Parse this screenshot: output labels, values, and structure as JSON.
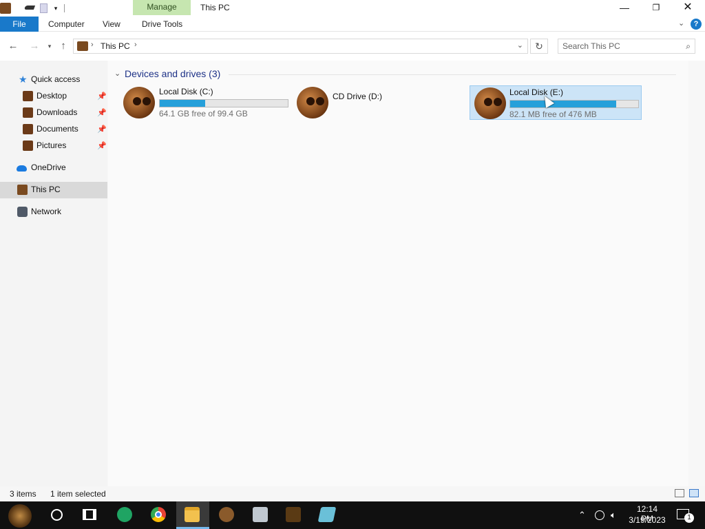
{
  "titlebar": {
    "manage_tab": "Manage",
    "title": "This PC",
    "minimize": "—",
    "maximize": "❐",
    "close": "✕"
  },
  "ribbon": {
    "tabs": [
      "File",
      "Computer",
      "View",
      "Drive Tools"
    ],
    "help": "?"
  },
  "address": {
    "location": "This PC",
    "search_placeholder": "Search This PC"
  },
  "nav": {
    "quick_access": "Quick access",
    "pinned": [
      "Desktop",
      "Downloads",
      "Documents",
      "Pictures"
    ],
    "onedrive": "OneDrive",
    "this_pc": "This PC",
    "network": "Network"
  },
  "content": {
    "group_title": "Devices and drives (3)",
    "drives": [
      {
        "name": "Local Disk (C:)",
        "free": "64.1 GB free of 99.4 GB",
        "used_fraction": 0.355
      },
      {
        "name": "CD Drive (D:)"
      },
      {
        "name": "Local Disk (E:)",
        "free": "82.1 MB free of 476 MB",
        "used_fraction": 0.828
      }
    ]
  },
  "status": {
    "items": "3 items",
    "selected": "1 item selected"
  },
  "taskbar": {
    "time": "12:14 PM",
    "date": "3/19/2023",
    "notifications": "1"
  },
  "icons": {
    "back": "back-arrow-icon",
    "forward": "forward-arrow-icon",
    "up": "up-arrow-icon",
    "refresh": "refresh-icon",
    "search": "search-icon",
    "quick_access": "star-icon",
    "onedrive": "cloud-icon",
    "network": "network-icon"
  },
  "colors": {
    "file_tab": "#1979ca",
    "manage_tab": "#c6e6b0",
    "selection": "#cce4f7",
    "usage_bar": "#26a0da",
    "group_title": "#1e3287"
  }
}
